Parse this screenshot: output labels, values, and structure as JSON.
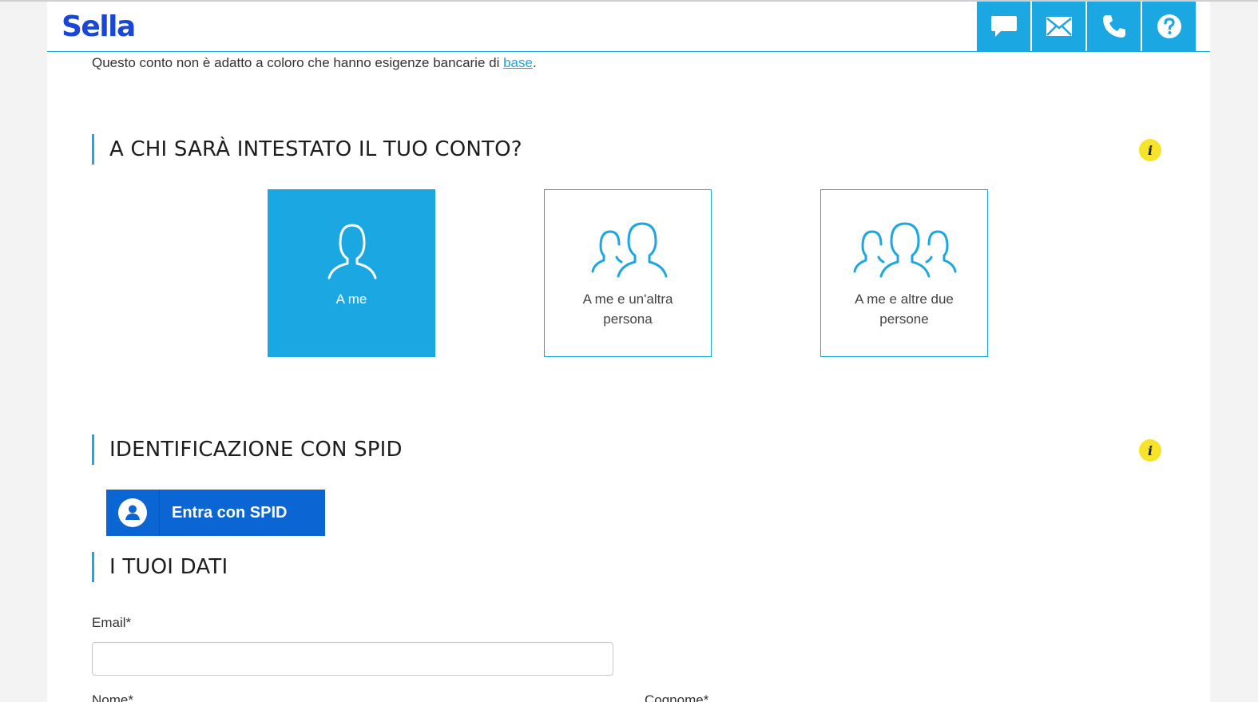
{
  "brand": {
    "name": "Sella",
    "logo_color": "#1746d8",
    "accent": "#1ba7e2",
    "info_color": "#f7e32a"
  },
  "header": {
    "buttons": [
      {
        "name": "chat-button",
        "icon": "chat-bubble-icon"
      },
      {
        "name": "email-button",
        "icon": "envelope-icon"
      },
      {
        "name": "phone-button",
        "icon": "phone-icon"
      },
      {
        "name": "help-button",
        "icon": "question-circle-icon"
      }
    ]
  },
  "disclaimer": {
    "text": "Questo conto non è adatto a coloro che hanno esigenze bancarie di ",
    "link": "base",
    "suffix": "."
  },
  "sections": {
    "holders": {
      "title": "A CHI SARÀ INTESTATO IL TUO CONTO?",
      "options": [
        {
          "label": "A me",
          "icon": "single-user-icon",
          "selected": true
        },
        {
          "label": "A me e un'altra persona",
          "icon": "two-users-icon",
          "selected": false
        },
        {
          "label": "A me e altre due persone",
          "icon": "three-users-icon",
          "selected": false
        }
      ]
    },
    "spid": {
      "title": "IDENTIFICAZIONE CON SPID",
      "button_label": "Entra con SPID",
      "button_color": "#0b66d4"
    },
    "data": {
      "title": "I TUOI DATI",
      "email_label": "Email*",
      "email_value": "",
      "name_label": "Nome*",
      "surname_label": "Cognome*"
    }
  }
}
